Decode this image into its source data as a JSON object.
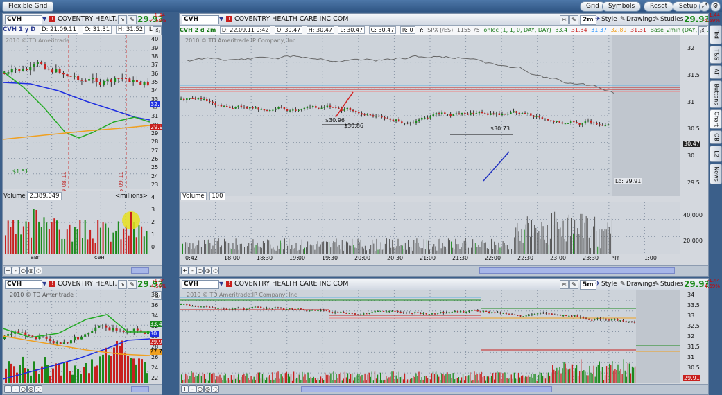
{
  "app": {
    "title": "Flexible Grid",
    "buttons": [
      "Grid",
      "Symbols",
      "Reset",
      "Setup"
    ]
  },
  "colors": {
    "up": "#1c8a1c",
    "down": "#c8201e",
    "accent": "#2b3a8f",
    "blue_line": "#1e2ee0",
    "orange_line": "#f0a020",
    "green_line": "#22aa22"
  },
  "panels": {
    "tl": {
      "symbol": "CVH",
      "company": "COVENTRY HEALT...",
      "price": "29.93",
      "chg1": "-1.44",
      "chg2": "-4.59%",
      "info": {
        "name": "CVH 1 y D",
        "d": "D: 21.09.11",
        "o": "O: 31.31",
        "h": "H: 31.52",
        "l": "L: 29.9..."
      },
      "watermark": "2010 © TD Ameritrade",
      "yticks": [
        "40",
        "39",
        "38",
        "37",
        "36",
        "35",
        "34",
        "33",
        "32",
        "31",
        "30",
        "29",
        "28",
        "27",
        "26",
        "25",
        "24",
        "23"
      ],
      "badge_blue": "32.",
      "badge_red": "29.93",
      "vlines": [
        "19.08.11",
        "16.09.11"
      ],
      "small_label": "$1.51",
      "volume": {
        "label": "Volume",
        "value": "2,389,049",
        "unit": "<millions>",
        "yticks": [
          "4",
          "3",
          "2",
          "1",
          "0"
        ]
      },
      "xticks": [
        "авг",
        "сен"
      ]
    },
    "tr": {
      "symbol": "CVH",
      "company": "COVENTRY HEALTH CARE INC COM",
      "price": "29.93",
      "chg1": "-1.44",
      "chg2": "-4.59%",
      "interval": "2m",
      "style": "Style",
      "drawings": "Drawings",
      "studies": "Studies",
      "info": [
        "CVH 2 d 2m",
        "D: 22.09.11 0:42",
        "H: 30.47",
        "O: 30.47",
        "L: 30.47",
        "C: 30.47",
        "R: 0",
        "Y:",
        "SPX (/ES)",
        "1155.75",
        "ohloc (1, 1, 0, DAY, DAY)",
        "33.4",
        "31.34",
        "31.37",
        "32.89",
        "31.31",
        "Base_2min (DAY, 5, 0.0,..."
      ],
      "watermark": "2010 © TD Ameritrade IP Company, Inc.",
      "yticks": [
        "32",
        "31.5",
        "31",
        "30.5",
        "30",
        "29.5"
      ],
      "badge": "30.47",
      "annotations": {
        "a1": "$30.96",
        "a2": "$30.86",
        "a3": "$30.73",
        "lo": "Lo: 29.91"
      },
      "volume": {
        "label": "Volume",
        "value": "100",
        "yticks": [
          "40,000",
          "20,000"
        ]
      },
      "xticks": [
        "0:42",
        "18:00",
        "18:30",
        "19:00",
        "19:30",
        "20:00",
        "20:30",
        "21:00",
        "21:30",
        "22:00",
        "22:30",
        "23:00",
        "23:30",
        "Чт",
        "1:00"
      ]
    },
    "bl": {
      "symbol": "CVH",
      "company": "COVENTRY HEALT...",
      "price": "29.93",
      "chg1": "-1.44",
      "chg2": "-4.59%",
      "watermark": "2010 © TD Ameritrade",
      "yticks": [
        "38",
        "36",
        "34",
        "32",
        "30",
        "28",
        "26",
        "24",
        "22"
      ],
      "badges": {
        "green": "33.47",
        "blue": "30.",
        "red": "29.93",
        "orange": "27.78"
      }
    },
    "br": {
      "symbol": "CVH",
      "company": "COVENTRY HEALTH CARE INC COM",
      "price": "29.93",
      "chg1": "-1.44",
      "chg2": "-4.59%",
      "interval": "5m",
      "style": "Style",
      "drawings": "Drawings",
      "studies": "Studies",
      "watermark": "2010 © TD Ameritrade IP Company, Inc.",
      "yticks": [
        "34",
        "33.5",
        "33",
        "32.5",
        "32",
        "31.5",
        "31",
        "30.5",
        "30"
      ],
      "badge": "29.91"
    }
  },
  "sidetabs": [
    "Trd",
    "T&S",
    "AT",
    "Buttons",
    "Chart",
    "OB",
    "L2",
    "News"
  ]
}
